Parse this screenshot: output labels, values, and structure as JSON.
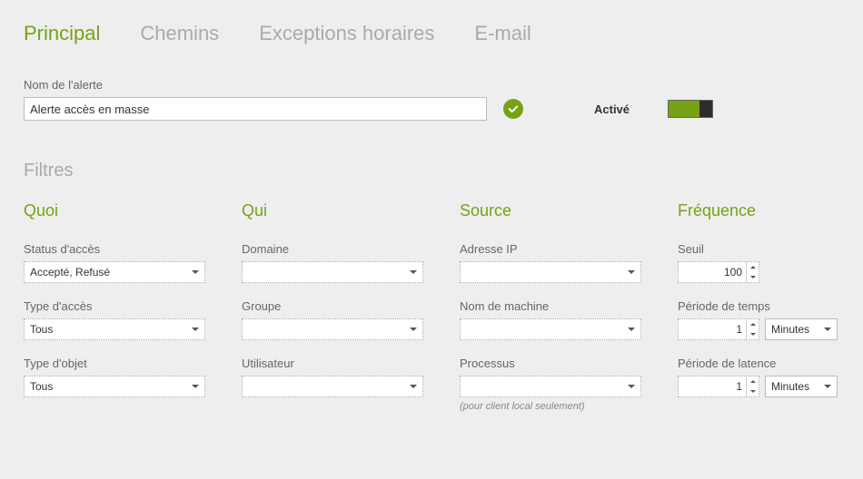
{
  "tabs": {
    "principal": "Principal",
    "chemins": "Chemins",
    "exceptions": "Exceptions horaires",
    "email": "E-mail"
  },
  "alert_name": {
    "label": "Nom de l'alerte",
    "value": "Alerte accès en masse"
  },
  "enabled_label": "Activé",
  "filters_title": "Filtres",
  "quoi": {
    "title": "Quoi",
    "status_label": "Status d'accès",
    "status_value": "Accepté, Refusé",
    "access_type_label": "Type d'accès",
    "access_type_value": "Tous",
    "object_type_label": "Type d'objet",
    "object_type_value": "Tous"
  },
  "qui": {
    "title": "Qui",
    "domain_label": "Domaine",
    "domain_value": "",
    "group_label": "Groupe",
    "group_value": "",
    "user_label": "Utilisateur",
    "user_value": ""
  },
  "source": {
    "title": "Source",
    "ip_label": "Adresse IP",
    "ip_value": "",
    "machine_label": "Nom de machine",
    "machine_value": "",
    "process_label": "Processus",
    "process_value": "",
    "process_hint": "(pour client local seulement)"
  },
  "frequence": {
    "title": "Fréquence",
    "threshold_label": "Seuil",
    "threshold_value": "100",
    "period_label": "Période de temps",
    "period_value": "1",
    "period_unit": "Minutes",
    "latency_label": "Période de latence",
    "latency_value": "1",
    "latency_unit": "Minutes"
  }
}
